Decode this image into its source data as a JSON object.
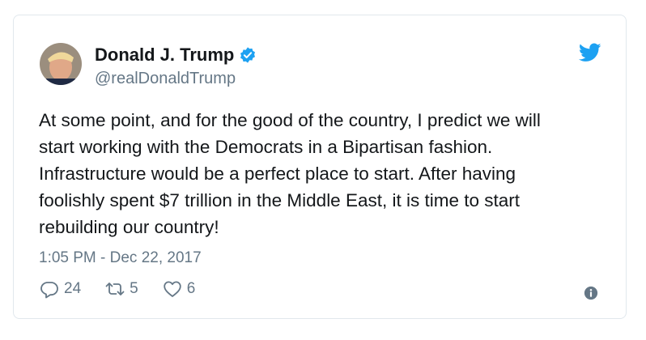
{
  "colors": {
    "twitter_blue": "#1da1f2",
    "text_primary": "#14171a",
    "text_secondary": "#657786",
    "border": "#e1e8ed"
  },
  "author": {
    "display_name": "Donald J. Trump",
    "handle": "@realDonaldTrump",
    "verified": true,
    "avatar_icon": "profile-photo"
  },
  "tweet": {
    "text": "At some point, and for the good of the country, I predict we will\nstart working with the Democrats in a Bipartisan fashion.\nInfrastructure would be a perfect place to start. After having\nfoolishly spent $7 trillion in the Middle East, it is time to start\nrebuilding our country!",
    "timestamp": "1:05 PM - Dec 22, 2017"
  },
  "actions": {
    "reply": {
      "icon": "reply-icon",
      "count": "24"
    },
    "retweet": {
      "icon": "retweet-icon",
      "count": "5"
    },
    "like": {
      "icon": "heart-icon",
      "count": "6"
    },
    "info": {
      "icon": "info-icon"
    }
  },
  "brand": {
    "icon": "twitter-bird-icon"
  }
}
